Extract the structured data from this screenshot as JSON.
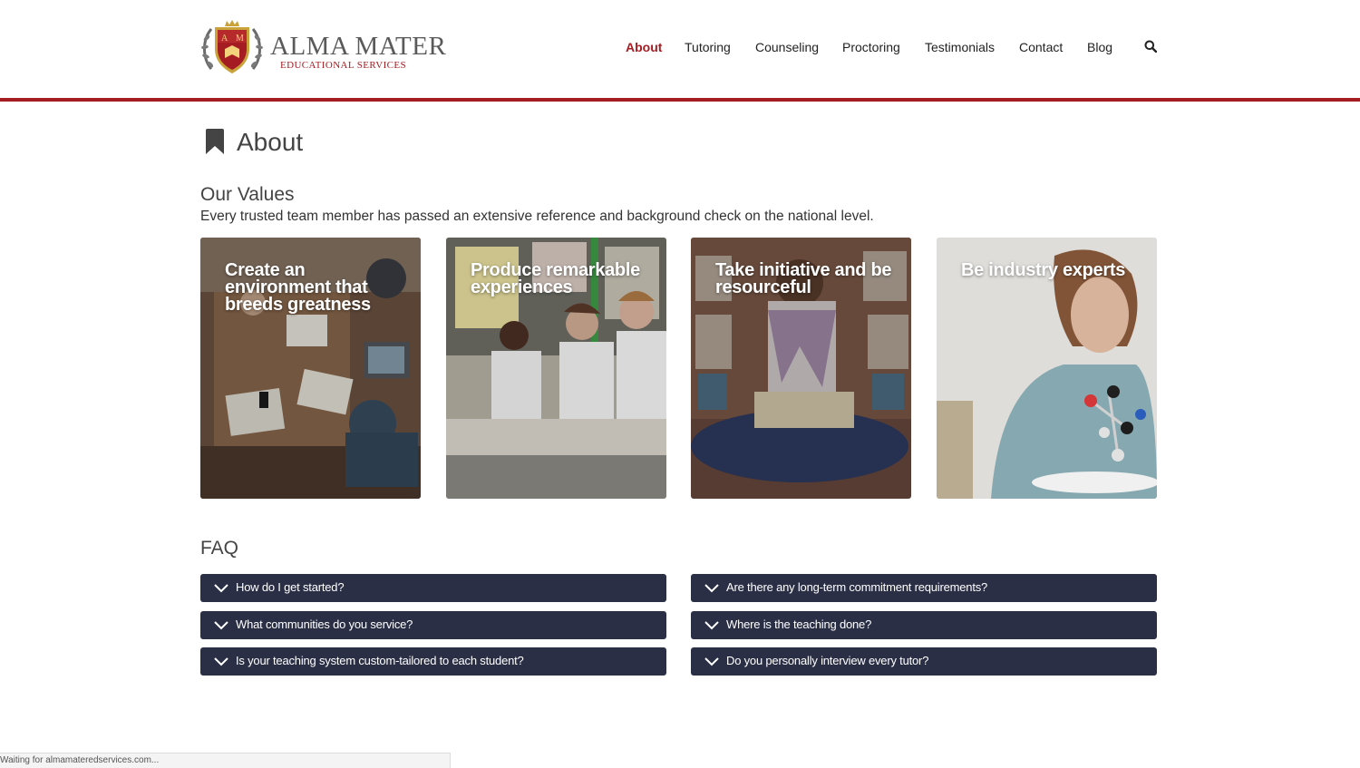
{
  "brand": {
    "name": "ALMA MATER",
    "subtitle": "EDUCATIONAL SERVICES",
    "crest_letters": "A M",
    "colors": {
      "accent": "#a51c22",
      "gold": "#c9a23a",
      "navy": "#2a2f45"
    }
  },
  "nav": {
    "items": [
      {
        "label": "About",
        "active": true
      },
      {
        "label": "Tutoring",
        "active": false
      },
      {
        "label": "Counseling",
        "active": false
      },
      {
        "label": "Proctoring",
        "active": false
      },
      {
        "label": "Testimonials",
        "active": false
      },
      {
        "label": "Contact",
        "active": false
      },
      {
        "label": "Blog",
        "active": false
      }
    ],
    "search_icon": "search-icon"
  },
  "page": {
    "title": "About",
    "title_icon": "bookmark-icon"
  },
  "values": {
    "heading": "Our Values",
    "subheading": "Every trusted team member has passed an extensive reference and background check on the national level.",
    "cards": [
      {
        "title": "Create an environment that breeds greatness",
        "image": "students-studying-at-table-photo"
      },
      {
        "title": "Produce remarkable experiences",
        "image": "students-in-classroom-photo"
      },
      {
        "title": "Take initiative and be resourceful",
        "image": "student-reading-in-library-photo"
      },
      {
        "title": "Be industry experts",
        "image": "teacher-with-molecule-model-photo"
      }
    ]
  },
  "faq": {
    "heading": "FAQ",
    "items": [
      {
        "question": "How do I get started?"
      },
      {
        "question": "Are there any long-term commitment requirements?"
      },
      {
        "question": "What communities do you service?"
      },
      {
        "question": "Where is the teaching done?"
      },
      {
        "question": "Is your teaching system custom-tailored to each student?"
      },
      {
        "question": "Do you personally interview every tutor?"
      }
    ]
  },
  "status_bar": {
    "text": "Waiting for almamateredservices.com..."
  }
}
